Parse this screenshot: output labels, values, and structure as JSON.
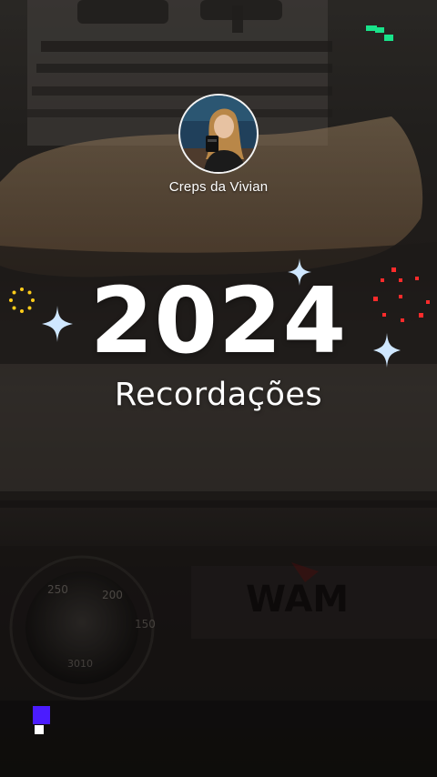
{
  "story": {
    "profile_name": "Creps da Vivian",
    "year": "2024",
    "subtitle": "Recordações"
  },
  "decor": {
    "sparkle_color": "#cfe7ff",
    "sparkle_glow": "#6fb7ff",
    "green_pixels": "#19e38a",
    "red_dots": "#ff2b2b",
    "yellow_ring": "#ffcc1a",
    "purple_block": "#4b1cff"
  }
}
